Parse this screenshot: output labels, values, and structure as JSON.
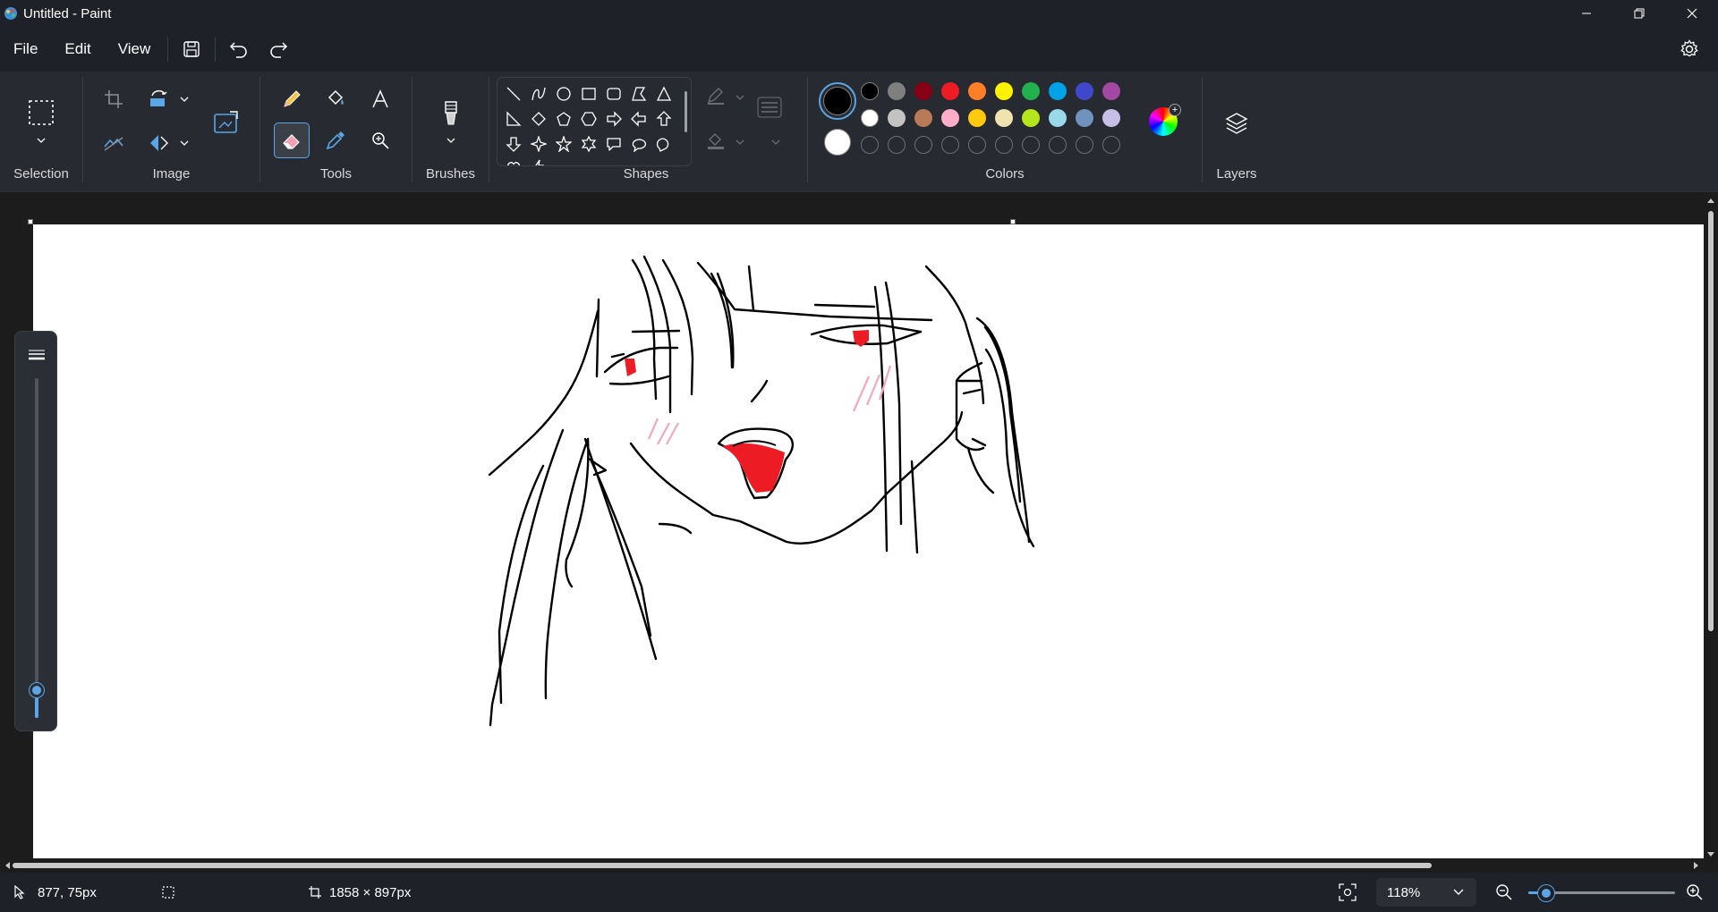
{
  "window": {
    "title": "Untitled - Paint",
    "minimize_icon": "minimize-icon",
    "restore_icon": "restore-icon",
    "close_icon": "close-icon"
  },
  "menu": {
    "items": [
      "File",
      "Edit",
      "View"
    ],
    "quick_actions": [
      "save-icon",
      "undo-icon",
      "redo-icon"
    ],
    "settings_icon": "gear-icon"
  },
  "ribbon": {
    "groups": {
      "selection": "Selection",
      "image": "Image",
      "tools": "Tools",
      "brushes": "Brushes",
      "shapes": "Shapes",
      "colors": "Colors",
      "layers": "Layers"
    },
    "active_tool": "eraser",
    "shapes": [
      "line",
      "curve",
      "oval",
      "rectangle",
      "rounded-rectangle",
      "polygon",
      "triangle",
      "right-triangle",
      "diamond",
      "pentagon",
      "hexagon",
      "right-arrow",
      "left-arrow",
      "up-arrow",
      "down-arrow",
      "four-point-star",
      "five-point-star",
      "six-point-star",
      "rectangular-callout",
      "oval-callout",
      "cloud-callout",
      "heart",
      "lightning"
    ],
    "primary_color": "#000000",
    "secondary_color": "#ffffff",
    "palette_row1": [
      "#000000",
      "#7f7f7f",
      "#880015",
      "#ed1c24",
      "#ff7f27",
      "#fff200",
      "#22b14c",
      "#00a2e8",
      "#3f48cc",
      "#a349a4"
    ],
    "palette_row2": [
      "#ffffff",
      "#c3c3c3",
      "#b97a57",
      "#ffaec9",
      "#ffc90e",
      "#efe4b0",
      "#b5e61d",
      "#99d9ea",
      "#7092be",
      "#c8bfe7"
    ],
    "palette_row3_count": 10
  },
  "brush_size": {
    "level": 0.06
  },
  "status": {
    "cursor_position": "877, 75px",
    "canvas_size": "1858 × 897px",
    "zoom": "118%",
    "zoom_level": 0.12
  },
  "accent_color": "#5aa6e6"
}
